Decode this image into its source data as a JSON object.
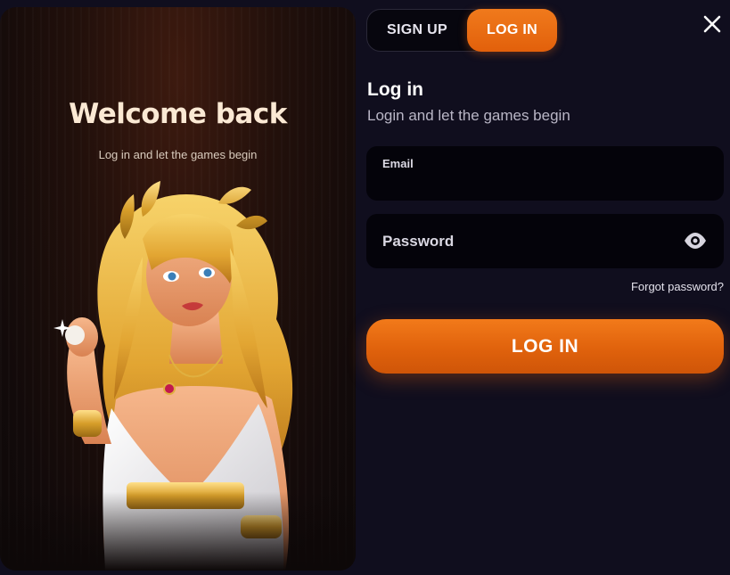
{
  "promo": {
    "title": "Welcome back",
    "subtitle": "Log in and let the games begin"
  },
  "tabs": [
    {
      "label": "SIGN UP",
      "active": false
    },
    {
      "label": "LOG IN",
      "active": true
    }
  ],
  "form": {
    "title": "Log in",
    "subtitle": "Login and let the games begin",
    "email_label": "Email",
    "email_value": "",
    "password_placeholder": "Password",
    "password_value": "",
    "forgot_label": "Forgot password?",
    "submit_label": "LOG IN"
  },
  "icons": {
    "close": "close-icon",
    "password_toggle": "eye-icon"
  },
  "colors": {
    "accent": "#e9680f",
    "background": "#100e1e",
    "field_bg": "#04030a"
  }
}
